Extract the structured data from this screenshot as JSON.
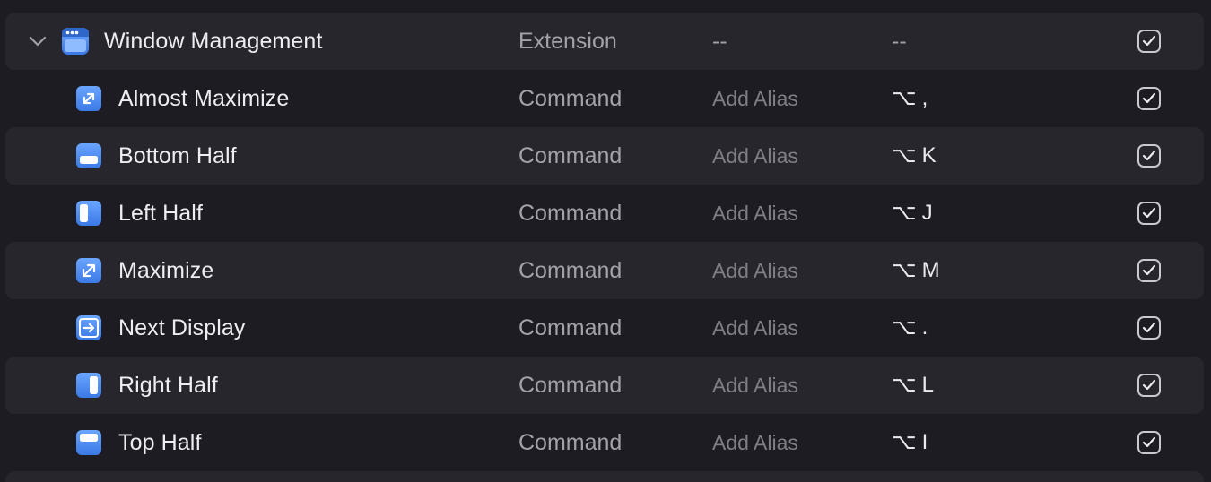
{
  "colors": {
    "background": "#1d1c22",
    "stripe": "#27262c",
    "icon_blue": "#4d8ef0",
    "text_primary": "#eeeef2",
    "text_secondary": "#a3a2aa"
  },
  "group": {
    "title": "Window Management",
    "type": "Extension",
    "alias": "--",
    "hotkey": "--",
    "enabled": true,
    "icon": "window-management-icon",
    "expanded": true
  },
  "commands": [
    {
      "title": "Almost Maximize",
      "type": "Command",
      "alias": "Add Alias",
      "hotkey_mod": "⌥",
      "hotkey_key": ",",
      "enabled": true,
      "icon": "almost-maximize-icon"
    },
    {
      "title": "Bottom Half",
      "type": "Command",
      "alias": "Add Alias",
      "hotkey_mod": "⌥",
      "hotkey_key": "K",
      "enabled": true,
      "icon": "bottom-half-icon"
    },
    {
      "title": "Left Half",
      "type": "Command",
      "alias": "Add Alias",
      "hotkey_mod": "⌥",
      "hotkey_key": "J",
      "enabled": true,
      "icon": "left-half-icon"
    },
    {
      "title": "Maximize",
      "type": "Command",
      "alias": "Add Alias",
      "hotkey_mod": "⌥",
      "hotkey_key": "M",
      "enabled": true,
      "icon": "maximize-icon"
    },
    {
      "title": "Next Display",
      "type": "Command",
      "alias": "Add Alias",
      "hotkey_mod": "⌥",
      "hotkey_key": ".",
      "enabled": true,
      "icon": "next-display-icon"
    },
    {
      "title": "Right Half",
      "type": "Command",
      "alias": "Add Alias",
      "hotkey_mod": "⌥",
      "hotkey_key": "L",
      "enabled": true,
      "icon": "right-half-icon"
    },
    {
      "title": "Top Half",
      "type": "Command",
      "alias": "Add Alias",
      "hotkey_mod": "⌥",
      "hotkey_key": "I",
      "enabled": true,
      "icon": "top-half-icon"
    }
  ]
}
